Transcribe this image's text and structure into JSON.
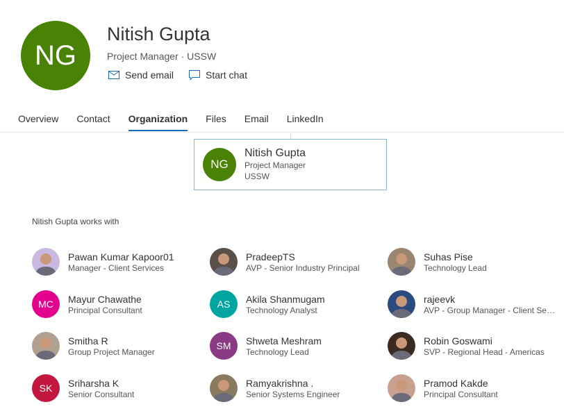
{
  "profile": {
    "initials": "NG",
    "name": "Nitish Gupta",
    "subtitle": "Project Manager · USSW",
    "color": "#498205"
  },
  "actions": {
    "send_email": "Send email",
    "start_chat": "Start chat"
  },
  "tabs": [
    {
      "label": "Overview"
    },
    {
      "label": "Contact"
    },
    {
      "label": "Organization",
      "active": true
    },
    {
      "label": "Files"
    },
    {
      "label": "Email"
    },
    {
      "label": "LinkedIn"
    }
  ],
  "card": {
    "initials": "NG",
    "name": "Nitish Gupta",
    "title": "Project Manager",
    "dept": "USSW"
  },
  "works_with_label": "Nitish Gupta works with",
  "people": [
    {
      "name": "Pawan Kumar Kapoor01",
      "title": "Manager - Client Services",
      "photo": true,
      "color": "#c9b8e0"
    },
    {
      "name": "PradeepTS",
      "title": "AVP - Senior Industry Principal",
      "photo": true,
      "color": "#5a5048"
    },
    {
      "name": "Suhas Pise",
      "title": "Technology Lead",
      "photo": true,
      "color": "#9a8570"
    },
    {
      "name": "Mayur Chawathe",
      "title": "Principal Consultant",
      "initials": "MC",
      "color": "#e3008c"
    },
    {
      "name": "Akila Shanmugam",
      "title": "Technology Analyst",
      "initials": "AS",
      "color": "#00a5a0"
    },
    {
      "name": "rajeevk",
      "title": "AVP - Group Manager - Client Services",
      "photo": true,
      "color": "#2a4a80"
    },
    {
      "name": "Smitha R",
      "title": "Group Project Manager",
      "photo": true,
      "color": "#b0a090"
    },
    {
      "name": "Shweta Meshram",
      "title": "Technology Lead",
      "initials": "SM",
      "color": "#8b3a86"
    },
    {
      "name": "Robin Goswami",
      "title": "SVP - Regional Head - Americas",
      "photo": true,
      "color": "#3a2a20"
    },
    {
      "name": "Sriharsha K",
      "title": "Senior Consultant",
      "initials": "SK",
      "color": "#c4173f"
    },
    {
      "name": "Ramyakrishna .",
      "title": "Senior Systems Engineer",
      "photo": true,
      "color": "#8a7a60"
    },
    {
      "name": "Pramod Kakde",
      "title": "Principal Consultant",
      "photo": true,
      "color": "#c8a090"
    }
  ]
}
